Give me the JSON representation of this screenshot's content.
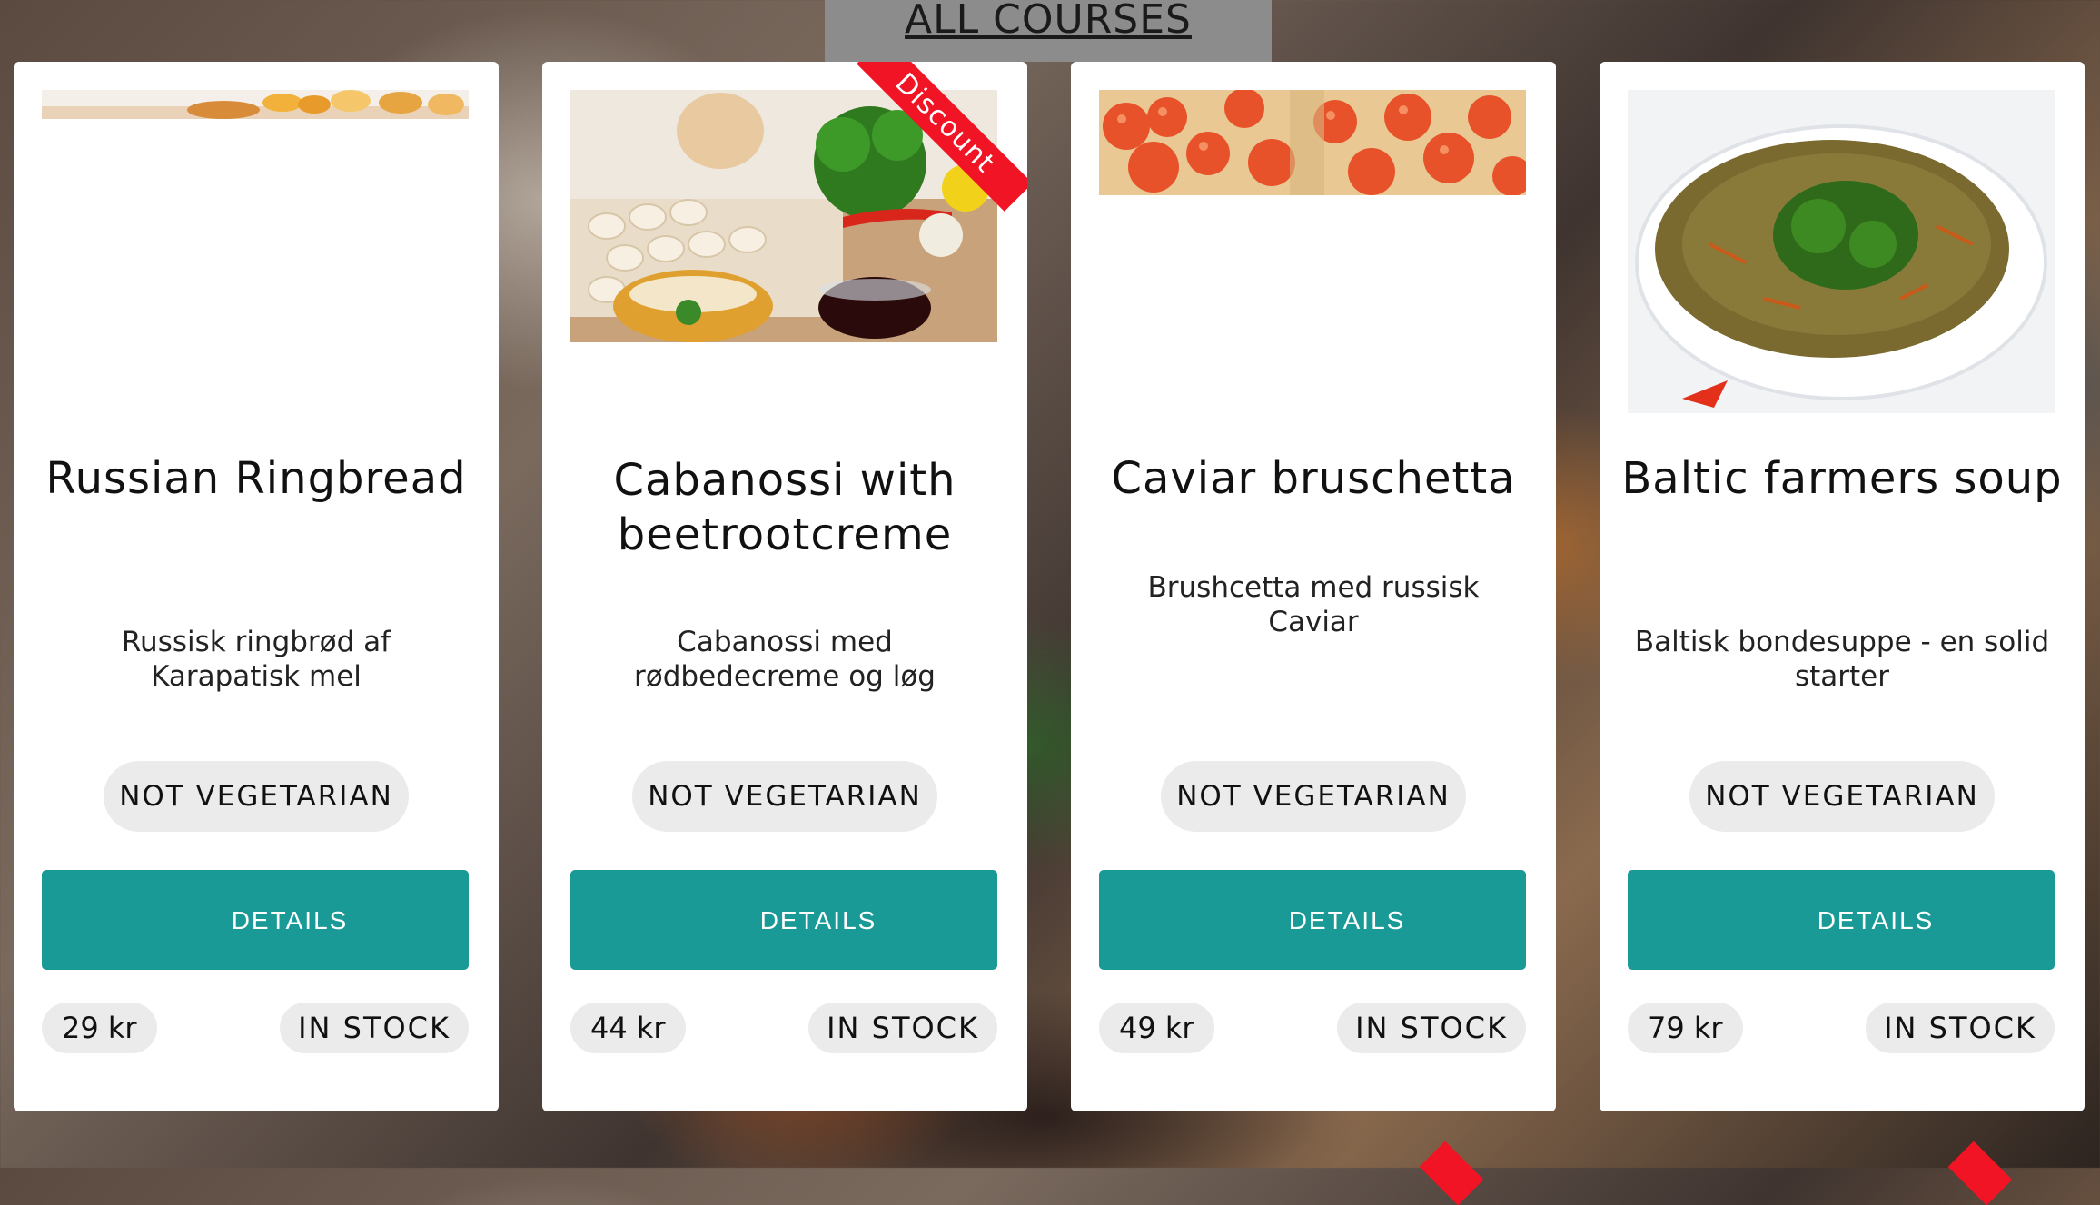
{
  "header": {
    "title": "ALL COURSES"
  },
  "cards": [
    {
      "title": "Russian Ringbread",
      "description": "Russisk ringbrød af Karapatisk mel",
      "diet": "NOT VEGETARIAN",
      "button": "DETAILS",
      "price": "29 kr",
      "stock": "IN STOCK"
    },
    {
      "title": "Cabanossi with beetrootcreme",
      "description": "Cabanossi med rødbedecreme og løg",
      "diet": "NOT VEGETARIAN",
      "button": "DETAILS",
      "price": "44 kr",
      "stock": "IN STOCK",
      "ribbon": "Discount"
    },
    {
      "title": "Caviar bruschetta",
      "description": "Brushcetta med russisk Caviar",
      "diet": "NOT VEGETARIAN",
      "button": "DETAILS",
      "price": "49 kr",
      "stock": "IN STOCK"
    },
    {
      "title": "Baltic farmers soup",
      "description": "Baltisk bondesuppe - en solid starter",
      "diet": "NOT VEGETARIAN",
      "button": "DETAILS",
      "price": "79 kr",
      "stock": "IN STOCK"
    }
  ],
  "colors": {
    "accent": "#1a9a96",
    "ribbon": "#f01424",
    "badge": "#ebebeb"
  }
}
